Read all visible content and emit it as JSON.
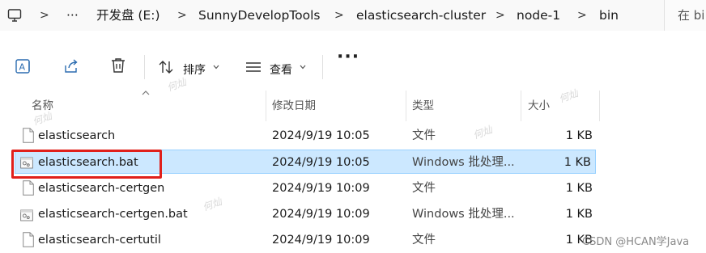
{
  "address": {
    "more": "···",
    "segments": [
      "开发盘 (E:)",
      "SunnyDevelopTools",
      "elasticsearch-cluster",
      "node-1",
      "bin"
    ],
    "search_placeholder": "在 bi"
  },
  "toolbar": {
    "sort_label": "排序",
    "view_label": "查看",
    "more": "···"
  },
  "columns": {
    "name": "名称",
    "modified": "修改日期",
    "type": "类型",
    "size": "大小"
  },
  "files": [
    {
      "name": "elasticsearch",
      "modified": "2024/9/19 10:05",
      "type": "文件",
      "size": "1 KB",
      "icon": "generic-file-icon",
      "selected": false
    },
    {
      "name": "elasticsearch.bat",
      "modified": "2024/9/19 10:05",
      "type": "Windows 批处理...",
      "size": "1 KB",
      "icon": "batch-file-icon",
      "selected": true
    },
    {
      "name": "elasticsearch-certgen",
      "modified": "2024/9/19 10:09",
      "type": "文件",
      "size": "1 KB",
      "icon": "generic-file-icon",
      "selected": false
    },
    {
      "name": "elasticsearch-certgen.bat",
      "modified": "2024/9/19 10:09",
      "type": "Windows 批处理...",
      "size": "1 KB",
      "icon": "batch-file-icon",
      "selected": false
    },
    {
      "name": "elasticsearch-certutil",
      "modified": "2024/9/19 10:09",
      "type": "文件",
      "size": "1 KB",
      "icon": "generic-file-icon",
      "selected": false
    }
  ],
  "watermark": "CSDN @HCAN学Java",
  "colors": {
    "selection_bg": "#cce8ff",
    "selection_border": "#99d1ff",
    "highlight_box": "#e0201b"
  }
}
